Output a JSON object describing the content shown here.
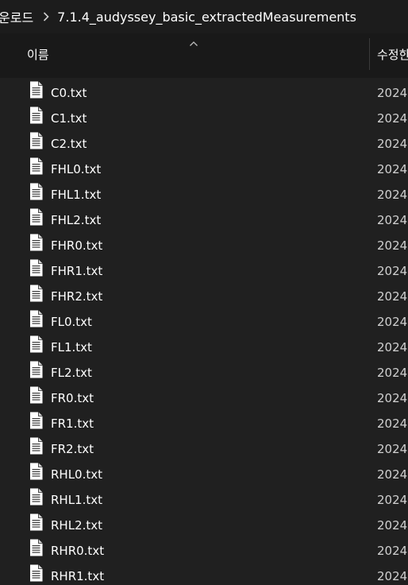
{
  "breadcrumb": {
    "items": [
      "운로드",
      "7.1.4_audyssey_basic_extractedMeasurements"
    ],
    "separator_icon": "chevron-right-icon"
  },
  "header": {
    "sort_icon": "sort-ascending-icon",
    "name_label": "이름",
    "date_label": "수정한"
  },
  "files": [
    {
      "name": "C0.txt",
      "date": "2024"
    },
    {
      "name": "C1.txt",
      "date": "2024"
    },
    {
      "name": "C2.txt",
      "date": "2024"
    },
    {
      "name": "FHL0.txt",
      "date": "2024"
    },
    {
      "name": "FHL1.txt",
      "date": "2024"
    },
    {
      "name": "FHL2.txt",
      "date": "2024"
    },
    {
      "name": "FHR0.txt",
      "date": "2024"
    },
    {
      "name": "FHR1.txt",
      "date": "2024"
    },
    {
      "name": "FHR2.txt",
      "date": "2024"
    },
    {
      "name": "FL0.txt",
      "date": "2024"
    },
    {
      "name": "FL1.txt",
      "date": "2024"
    },
    {
      "name": "FL2.txt",
      "date": "2024"
    },
    {
      "name": "FR0.txt",
      "date": "2024"
    },
    {
      "name": "FR1.txt",
      "date": "2024"
    },
    {
      "name": "FR2.txt",
      "date": "2024"
    },
    {
      "name": "RHL0.txt",
      "date": "2024"
    },
    {
      "name": "RHL1.txt",
      "date": "2024"
    },
    {
      "name": "RHL2.txt",
      "date": "2024"
    },
    {
      "name": "RHR0.txt",
      "date": "2024"
    },
    {
      "name": "RHR1.txt",
      "date": "2024"
    }
  ],
  "file_icon": "text-file-icon",
  "colors": {
    "list_background": "#202020",
    "header_background": "#191919",
    "text": "#ffffff"
  }
}
